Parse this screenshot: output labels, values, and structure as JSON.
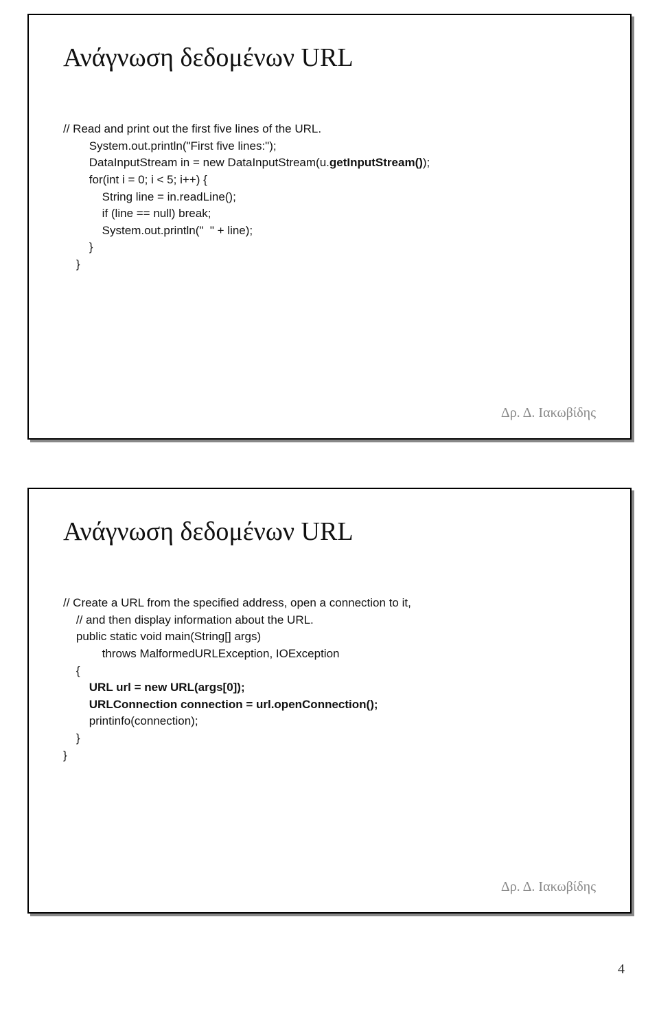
{
  "slide1": {
    "title": "Ανάγνωση δεδομένων URL",
    "code_c1": "// Read and print out the first five lines of the URL.",
    "code_l1": "        System.out.println(\"First five lines:\");",
    "code_l2a": "        DataInputStream in = new DataInputStream(u.",
    "code_l2b": "getInputStream()",
    "code_l2c": ");",
    "code_l3": "        for(int i = 0; i < 5; i++) {",
    "code_l4": "            String line = in.readLine();",
    "code_l5": "            if (line == null) break;",
    "code_l6": "            System.out.println(\"  \" + line);",
    "code_l7": "        }",
    "code_l8": "    }",
    "footer": "Δρ. Δ. Ιακωβίδης"
  },
  "slide2": {
    "title": "Ανάγνωση δεδομένων URL",
    "code_c1": "// Create a URL from the specified address, open a connection to it,",
    "code_c2": "    // and then display information about the URL.",
    "code_l1": "    public static void main(String[] args)",
    "code_l2": "            throws MalformedURLException, IOException",
    "code_l3": "    {",
    "code_l4": "        URL url = new URL(args[0]);",
    "code_l5": "        URLConnection connection = url.openConnection();",
    "code_l6": "        printinfo(connection);",
    "code_l7": "    }",
    "code_l8": "}",
    "footer": "Δρ. Δ. Ιακωβίδης"
  },
  "page_num": "4"
}
